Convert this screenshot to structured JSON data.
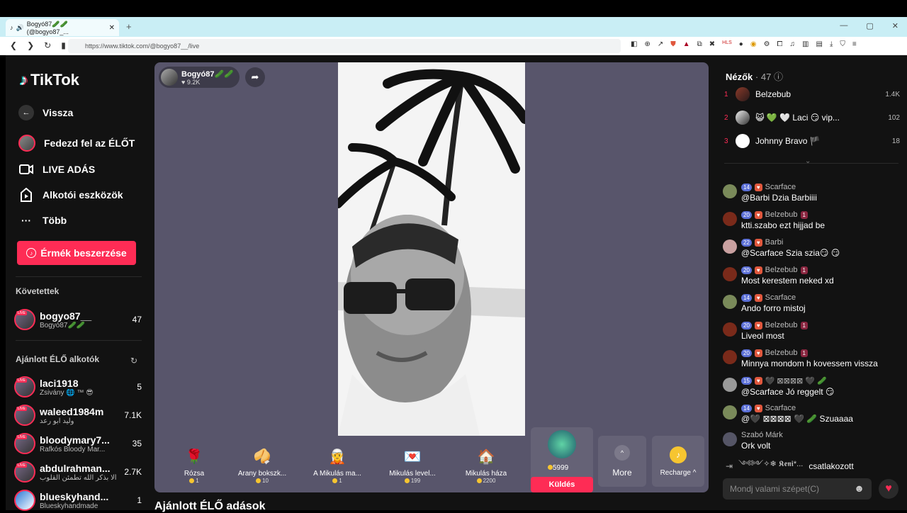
{
  "browser": {
    "tab_title": "Bogyó87🥒🥒 (@bogyo87_...",
    "url": "https://www.tiktok.com/@bogyo87__/live"
  },
  "sidebar": {
    "logo": "TikTok",
    "back": "Vissza",
    "items": [
      {
        "label": "Fedezd fel az ÉLŐT",
        "icon": "avatar-icon"
      },
      {
        "label": "LIVE ADÁS",
        "icon": "camera-icon"
      },
      {
        "label": "Alkotói eszközök",
        "icon": "creator-tools-icon"
      },
      {
        "label": "Több",
        "icon": "more-icon"
      }
    ],
    "coins_button": "Érmék beszerzése",
    "following_title": "Követettek",
    "following": [
      {
        "name": "bogyo87__",
        "sub": "Bogyó87🥒🥒",
        "count": "47"
      }
    ],
    "recommended_title": "Ajánlott ÉLŐ alkotók",
    "recommended": [
      {
        "name": "laci1918",
        "sub": "Zsivány 🌐 ™ 😎",
        "count": "5"
      },
      {
        "name": "waleed1984m",
        "sub": "وليد ابو رعد",
        "count": "7.1K"
      },
      {
        "name": "bloodymary7...",
        "sub": "Rafkós Bloody Mar...",
        "count": "35"
      },
      {
        "name": "abdulrahman...",
        "sub": "ألا بذكر الله تطمئن القلوب",
        "count": "2.7K"
      },
      {
        "name": "blueskyhand...",
        "sub": "Blueskyhandmade",
        "count": "1"
      }
    ]
  },
  "stage": {
    "host_name": "Bogyó87🥒🥒",
    "host_likes": "♥ 9.2K",
    "gifts": [
      {
        "name": "Rózsa",
        "price": "1",
        "icon": "🌹"
      },
      {
        "name": "Arany bokszk...",
        "price": "10",
        "icon": "🥠"
      },
      {
        "name": "A Mikulás ma...",
        "price": "1",
        "icon": "🧝"
      },
      {
        "name": "Mikulás level...",
        "price": "199",
        "icon": "💌"
      },
      {
        "name": "Mikulás háza",
        "price": "2200",
        "icon": "🏠"
      }
    ],
    "selected_gift_price": "5999",
    "send_label": "Küldés",
    "more_label": "More",
    "recharge_label": "Recharge ^"
  },
  "recommended_lives": "Ajánlott ÉLŐ adások",
  "chat": {
    "viewers_label": "Nézők",
    "viewers_count": "· 47",
    "top_viewers": [
      {
        "rank": "1",
        "name": "Belzebub",
        "count": "1.4K"
      },
      {
        "rank": "2",
        "name": "😺 💚 🤍 Laci 😏 vip...",
        "count": "102"
      },
      {
        "rank": "3",
        "name": "Johnny Bravo 🏴",
        "count": "18"
      }
    ],
    "messages": [
      {
        "level": "14",
        "user": "Scarface",
        "text": "@Barbi Dzia Barbiiii",
        "avatar_color": "#7a8a5a"
      },
      {
        "level": "20",
        "user": "Belzebub",
        "team": "1",
        "text": "ktti.szabo ezt hijjad be",
        "avatar_color": "#7a2a1a"
      },
      {
        "level": "22",
        "user": "Barbi",
        "text": "@Scarface Szia szia😏 😏",
        "avatar_color": "#c9a0a0"
      },
      {
        "level": "20",
        "user": "Belzebub",
        "team": "1",
        "text": "Most kerestem neked xd",
        "avatar_color": "#7a2a1a"
      },
      {
        "level": "14",
        "user": "Scarface",
        "text": "Ando forro mistoj",
        "avatar_color": "#7a8a5a"
      },
      {
        "level": "20",
        "user": "Belzebub",
        "team": "1",
        "text": "Liveol most",
        "avatar_color": "#7a2a1a"
      },
      {
        "level": "20",
        "user": "Belzebub",
        "team": "1",
        "text": "Minnya mondom h kovessem vissza",
        "avatar_color": "#7a2a1a"
      },
      {
        "level": "15",
        "user": "🖤 ⊠⊠⊠⊠ 🖤 🥒",
        "text": "@Scarface Jó reggelt 😏",
        "avatar_color": "#999"
      },
      {
        "level": "14",
        "user": "Scarface",
        "text": "@🖤 ⊠⊠⊠⊠ 🖤 🥒 Szuaaaa",
        "avatar_color": "#7a8a5a"
      },
      {
        "level": "",
        "user": "Szabó Márk",
        "text": "Ork volt",
        "avatar_color": "#556"
      }
    ],
    "joined_user": "༺༻✧❄ 𝕶𝖊𝖓𝖎*...",
    "joined_text": "csatlakozott",
    "input_placeholder": "Mondj valami szépet(C)"
  }
}
